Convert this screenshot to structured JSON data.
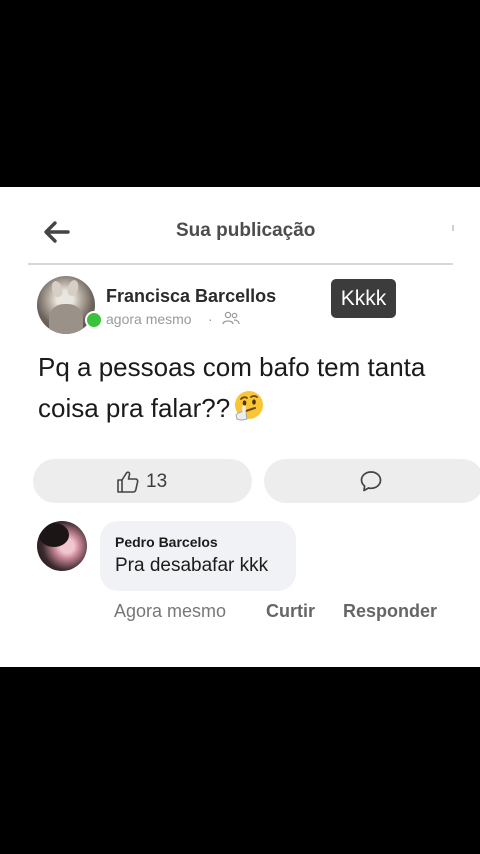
{
  "header": {
    "title": "Sua publicação",
    "back_icon": "back-arrow-icon"
  },
  "post": {
    "author": "Francisca Barcellos",
    "time": "agora mesmo",
    "separator": "·",
    "privacy_icon": "friends-icon",
    "text": "Pq a pessoas com bafo tem tanta coisa pra falar??",
    "emoji": "thinking-face",
    "like_count": "13",
    "like_icon": "thumbs-up-icon",
    "comment_icon": "comment-icon",
    "online_color": "#3bc13b"
  },
  "overlay_caption": "Kkkk",
  "comment": {
    "author": "Pedro Barcelos",
    "text": "Pra desabafar kkk",
    "time": "Agora mesmo",
    "like_label": "Curtir",
    "reply_label": "Responder"
  }
}
